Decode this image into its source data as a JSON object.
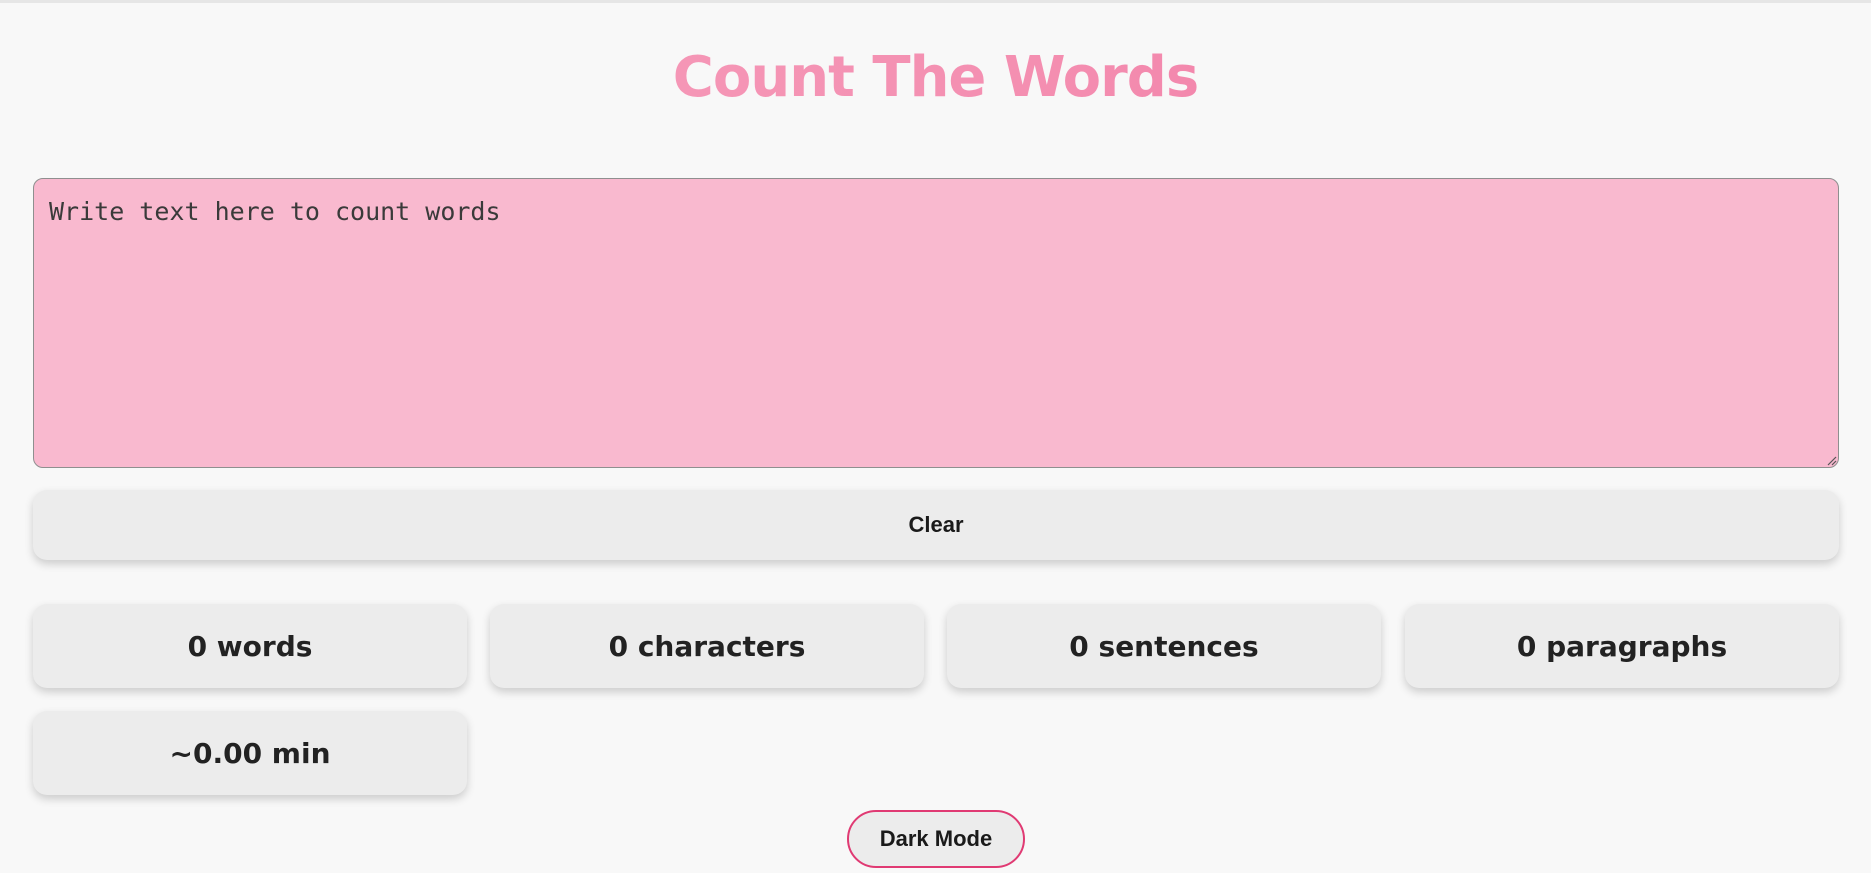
{
  "header": {
    "title": "Count The Words"
  },
  "editor": {
    "placeholder": "Write text here to count words",
    "value": ""
  },
  "actions": {
    "clear_label": "Clear",
    "dark_mode_label": "Dark Mode"
  },
  "stats": {
    "words": "0 words",
    "characters": "0 characters",
    "sentences": "0 sentences",
    "paragraphs": "0 paragraphs",
    "reading_time": "~0.00 min"
  },
  "colors": {
    "title_gradient": [
      "#f7a3bf",
      "#ee6d9d"
    ],
    "editor_background": "#f9b9cf",
    "card_background": "#ececec",
    "dark_mode_border": "#e03a73",
    "page_background": "#f8f8f8"
  },
  "icons": {
    "resize_handle": "resize-grip-icon"
  }
}
